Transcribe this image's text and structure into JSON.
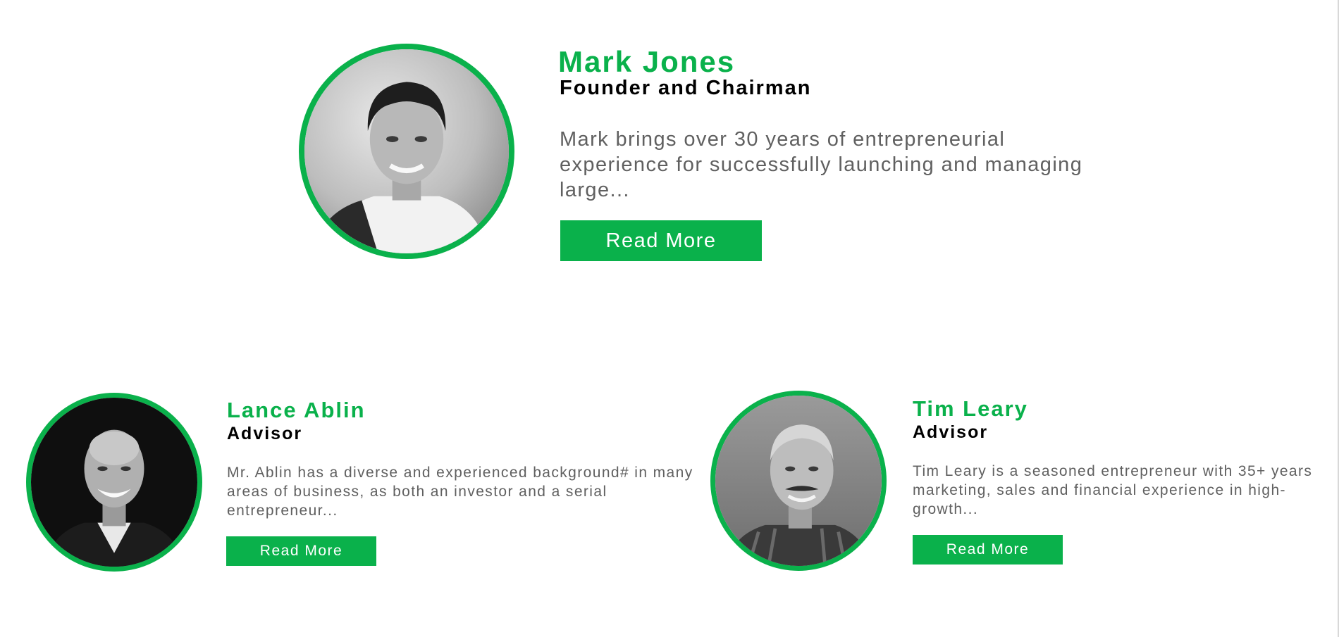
{
  "theme": {
    "accent": "#0ab14b",
    "text_dark": "#000000",
    "text_body": "#606060"
  },
  "members": [
    {
      "name": "Mark Jones",
      "role": "Founder and Chairman",
      "bio": "Mark brings over 30 years of entrepreneurial experience for successfully launching and managing large...",
      "button_label": "Read More",
      "photo": "portrait-photo"
    },
    {
      "name": "Lance Ablin",
      "role": "Advisor",
      "bio": "Mr. Ablin has a diverse and experienced background# in many areas of business, as both an investor and a serial entrepreneur...",
      "button_label": "Read More",
      "photo": "portrait-photo"
    },
    {
      "name": "Tim Leary",
      "role": "Advisor",
      "bio": "Tim Leary is a seasoned entrepreneur with 35+ years marketing, sales and financial experience in high-growth...",
      "button_label": "Read More",
      "photo": "portrait-photo"
    }
  ]
}
